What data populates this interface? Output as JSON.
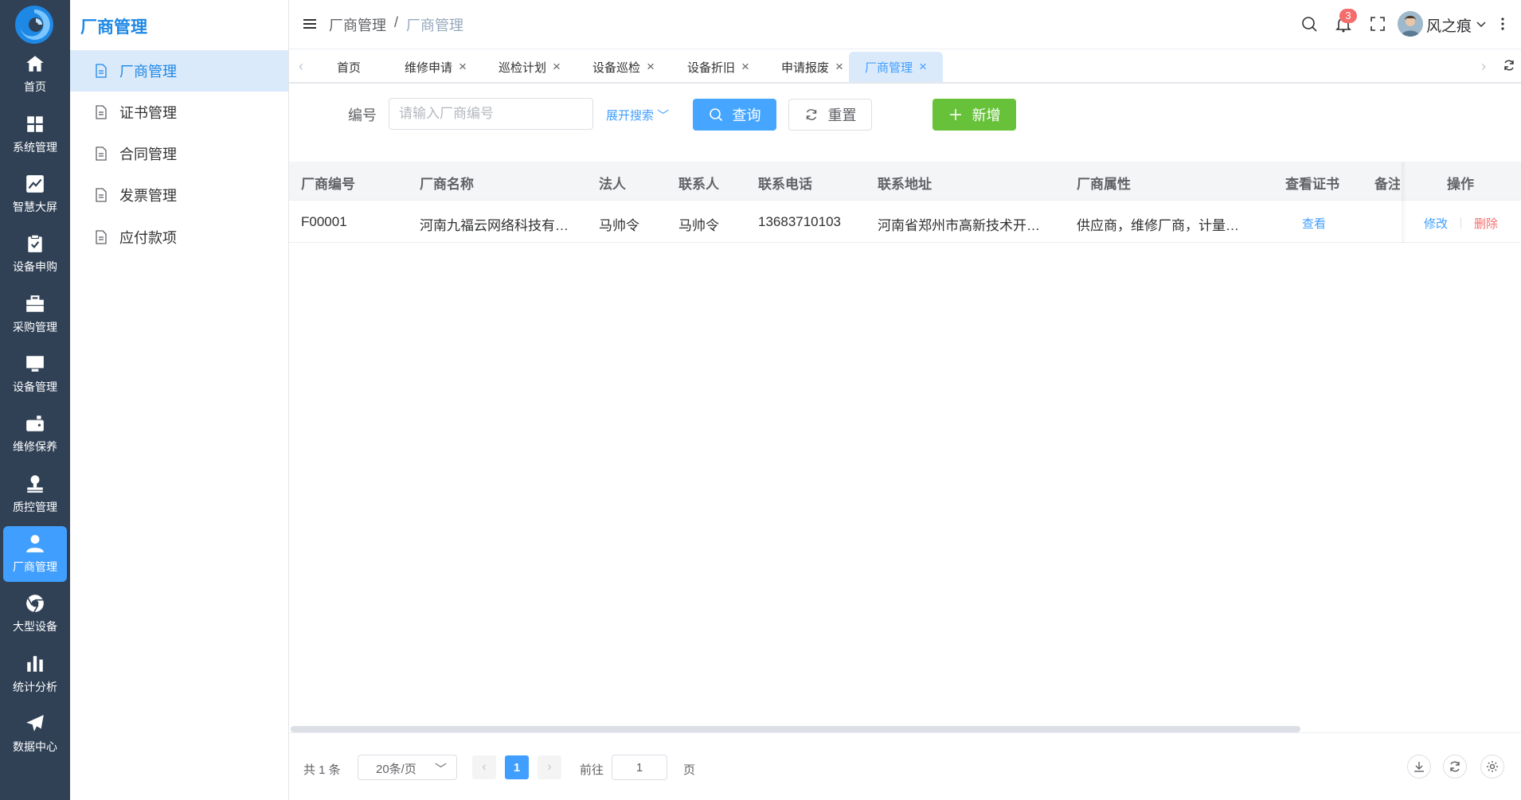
{
  "colors": {
    "rail_bg": "#304156",
    "accent": "#409eff",
    "add_green": "#67c23a",
    "danger": "#f56c6c"
  },
  "rail": {
    "items": [
      {
        "label": "首页",
        "icon": "home-icon"
      },
      {
        "label": "系统管理",
        "icon": "grid-icon"
      },
      {
        "label": "智慧大屏",
        "icon": "chart-line-icon"
      },
      {
        "label": "设备申购",
        "icon": "clipboard-check-icon"
      },
      {
        "label": "采购管理",
        "icon": "toolbox-icon"
      },
      {
        "label": "设备管理",
        "icon": "monitor-icon"
      },
      {
        "label": "维修保养",
        "icon": "wallet-icon"
      },
      {
        "label": "质控管理",
        "icon": "stamp-icon"
      },
      {
        "label": "厂商管理",
        "icon": "user-icon",
        "active": true
      },
      {
        "label": "大型设备",
        "icon": "chrome-icon"
      },
      {
        "label": "统计分析",
        "icon": "bar-chart-icon"
      },
      {
        "label": "数据中心",
        "icon": "paper-plane-icon"
      }
    ]
  },
  "submenu": {
    "title": "厂商管理",
    "items": [
      {
        "label": "厂商管理",
        "active": true
      },
      {
        "label": "证书管理"
      },
      {
        "label": "合同管理"
      },
      {
        "label": "发票管理"
      },
      {
        "label": "应付款项"
      }
    ]
  },
  "header": {
    "breadcrumb": [
      "厂商管理",
      "/",
      "厂商管理"
    ],
    "notification_count": "3",
    "username": "风之痕"
  },
  "tags": [
    {
      "label": "首页",
      "closable": false
    },
    {
      "label": "维修申请",
      "closable": true
    },
    {
      "label": "巡检计划",
      "closable": true
    },
    {
      "label": "设备巡检",
      "closable": true
    },
    {
      "label": "设备折旧",
      "closable": true
    },
    {
      "label": "申请报废",
      "closable": true
    },
    {
      "label": "厂商管理",
      "closable": true,
      "active": true
    }
  ],
  "search": {
    "label": "编号",
    "placeholder": "请输入厂商编号",
    "value": "",
    "expand_label": "展开搜索",
    "query_label": "查询",
    "reset_label": "重置",
    "add_label": "新增"
  },
  "table": {
    "columns": [
      "厂商编号",
      "厂商名称",
      "法人",
      "联系人",
      "联系电话",
      "联系地址",
      "厂商属性",
      "查看证书",
      "备注",
      "操作"
    ],
    "rows": [
      {
        "code": "F00001",
        "name": "河南九福云网络科技有…",
        "legal": "马帅令",
        "contact": "马帅令",
        "phone": "13683710103",
        "address": "河南省郑州市高新技术开…",
        "attr": "供应商，维修厂商，计量…",
        "cert": "查看",
        "remark": "",
        "edit": "修改",
        "delete": "删除"
      }
    ]
  },
  "pager": {
    "total": "共 1 条",
    "page_size": "20条/页",
    "current": "1",
    "goto_label": "前往",
    "goto_value": "1",
    "page_label": "页"
  }
}
